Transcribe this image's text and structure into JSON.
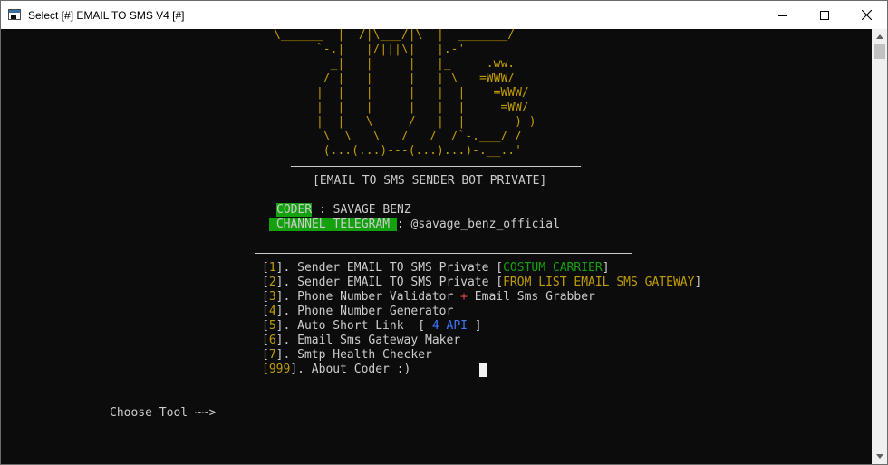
{
  "window": {
    "title": "Select [#] EMAIL TO SMS V4 [#]",
    "minimize_icon": "minimize-icon",
    "maximize_icon": "maximize-icon",
    "close_icon": "close-icon"
  },
  "banner": {
    "art": "\\______  |  /|\\___/|\\  |  _______/\n      `-.|   |/|||\\|   |.-'\n        _|   |     |   |_     .ww.\n       / |   |     |   | \\   =WWW/\n      |  |   |     |   |  |    =WWW/\n      |  |   |     |   |  |     =WW/\n      |  |   \\     /   |  |       ) )\n       \\  \\   \\   /   /  /`-.___/ /\n       (...(...)---(...)...)-.__..'",
    "subtitle": "[EMAIL TO SMS SENDER BOT PRIVATE]"
  },
  "credits": {
    "coder_label": "CODER",
    "coder_value": " : SAVAGE BENZ",
    "channel_label": " CHANNEL TELEGRAM ",
    "channel_value": ": @savage_benz_official"
  },
  "menu": {
    "items": [
      {
        "num": "1",
        "text": "]. Sender EMAIL TO SMS Private [",
        "tag": "COSTUM CARRIER",
        "close": "]"
      },
      {
        "num": "2",
        "text": "]. Sender EMAIL TO SMS Private [",
        "tag": "FROM LIST EMAIL SMS GATEWAY",
        "close": "]"
      },
      {
        "num": "3",
        "text": "]. Phone Number Validator ",
        "plus": "+",
        "text2": " Email Sms Grabber"
      },
      {
        "num": "4",
        "text": "]. Phone Number Generator"
      },
      {
        "num": "5",
        "text": "]. Auto Short Link  [ ",
        "tag": "4 API",
        "close": " ]"
      },
      {
        "num": "6",
        "text": "]. Email Sms Gateway Maker"
      },
      {
        "num": "7",
        "text": "]. Smtp Health Checker"
      },
      {
        "num": "999",
        "text": "]. About Coder :)"
      }
    ]
  },
  "prompt": {
    "text": "Choose Tool ~~>"
  },
  "colors": {
    "background": "#0c0c0c",
    "foreground": "#cccccc",
    "accent_yellow": "#c19c00",
    "accent_green": "#13a10e",
    "accent_red": "#e74856",
    "accent_blue": "#3b78ff"
  }
}
